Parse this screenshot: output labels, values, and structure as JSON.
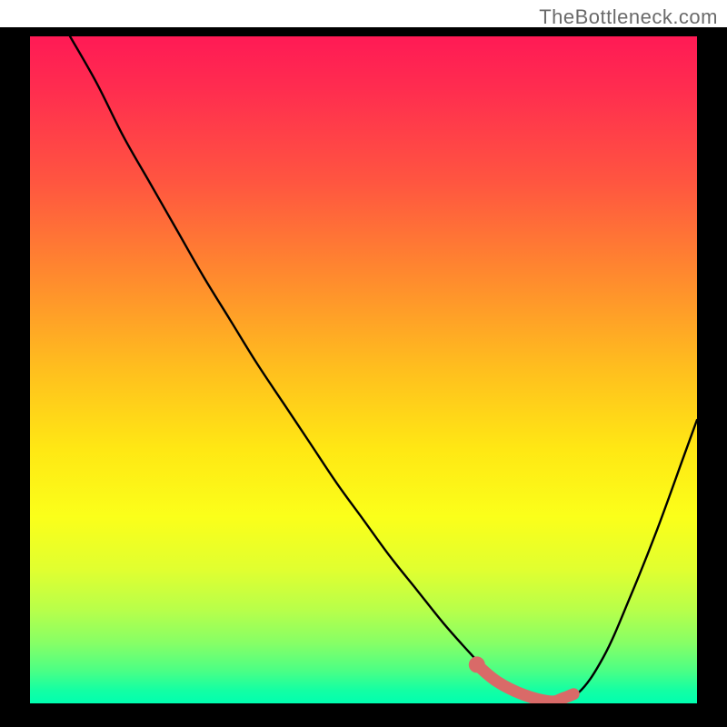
{
  "watermark": "TheBottleneck.com",
  "chart_data": {
    "type": "line",
    "title": "",
    "xlabel": "",
    "ylabel": "",
    "xlim": [
      0,
      100
    ],
    "ylim": [
      0,
      100
    ],
    "series": [
      {
        "name": "bottleneck-curve",
        "x": [
          6,
          10,
          14,
          18,
          22,
          26,
          30,
          34,
          38,
          42,
          46,
          50,
          54,
          58,
          62,
          66,
          70,
          74,
          78,
          82,
          86,
          90,
          94,
          98,
          100
        ],
        "y": [
          100,
          93,
          85,
          78,
          71,
          64,
          57.5,
          51,
          45,
          39,
          33,
          27.5,
          22,
          17,
          12,
          7.5,
          3.3,
          1.3,
          0.3,
          1.4,
          7,
          16,
          26,
          37,
          42.5
        ]
      }
    ],
    "highlight_segment": {
      "name": "optimal-range",
      "x": [
        67,
        70,
        74,
        78,
        80,
        81.5
      ],
      "y": [
        5.8,
        3.3,
        1.3,
        0.3,
        0.8,
        1.4
      ]
    },
    "background": {
      "gradient": "vertical",
      "top_color": "#ff1a55",
      "bottom_color": "#00ffb0",
      "meaning": "top = high bottleneck (red), bottom = low bottleneck (green)"
    }
  },
  "colors": {
    "frame": "#000000",
    "curve": "#000000",
    "highlight": "#d96a68",
    "highlight_end_dot": "#d96a68"
  }
}
